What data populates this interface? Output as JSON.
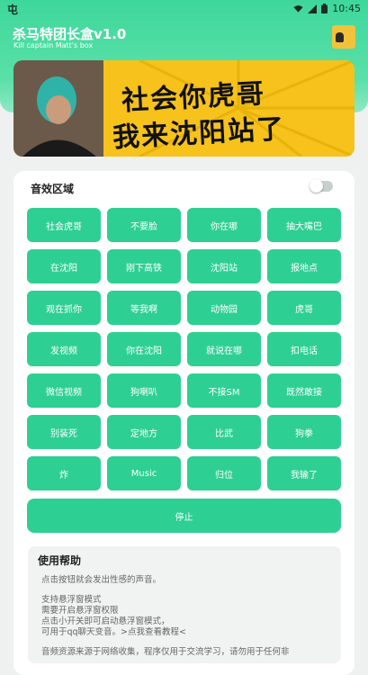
{
  "statusbar": {
    "left_glyph": "屯",
    "time": "10:45"
  },
  "app": {
    "title": "杀马特团长盒v1.0",
    "subtitle": "Kill captain Matt's box"
  },
  "banner": {
    "line1": "社会你虎哥",
    "line2": "我来沈阳站了"
  },
  "sound_area": {
    "title": "音效区域",
    "toggle_on": false
  },
  "buttons": [
    "社会虎哥",
    "不要脸",
    "你在哪",
    "抽大嘴巴",
    "在沈阳",
    "刚下高铁",
    "沈阳站",
    "报地点",
    "观在抓你",
    "等我啊",
    "动物园",
    "虎哥",
    "发视频",
    "你在沈阳",
    "就说在哪",
    "扣电话",
    "微信视频",
    "狗喇叭",
    "不接SM",
    "既然敢接",
    "别装死",
    "定地方",
    "比武",
    "狗拳",
    "炸",
    "Music",
    "归位",
    "我输了"
  ],
  "stop_label": "停止",
  "help": {
    "title": "使用帮助",
    "p1": "点击按钮就会发出性感的声音。",
    "p2_1": "支持悬浮窗模式",
    "p2_2": "需要开启悬浮窗权限",
    "p2_3": "点击小开关即可启动悬浮窗模式，",
    "p2_4": "可用于qq聊天变音。>点我查看教程<",
    "p3": "音频资源来源于网络收集，程序仅用于交流学习，请勿用于任何非"
  },
  "colors": {
    "accent": "#2ecf93",
    "header": "#3ed79b",
    "banner_bg": "#f6c21b"
  }
}
